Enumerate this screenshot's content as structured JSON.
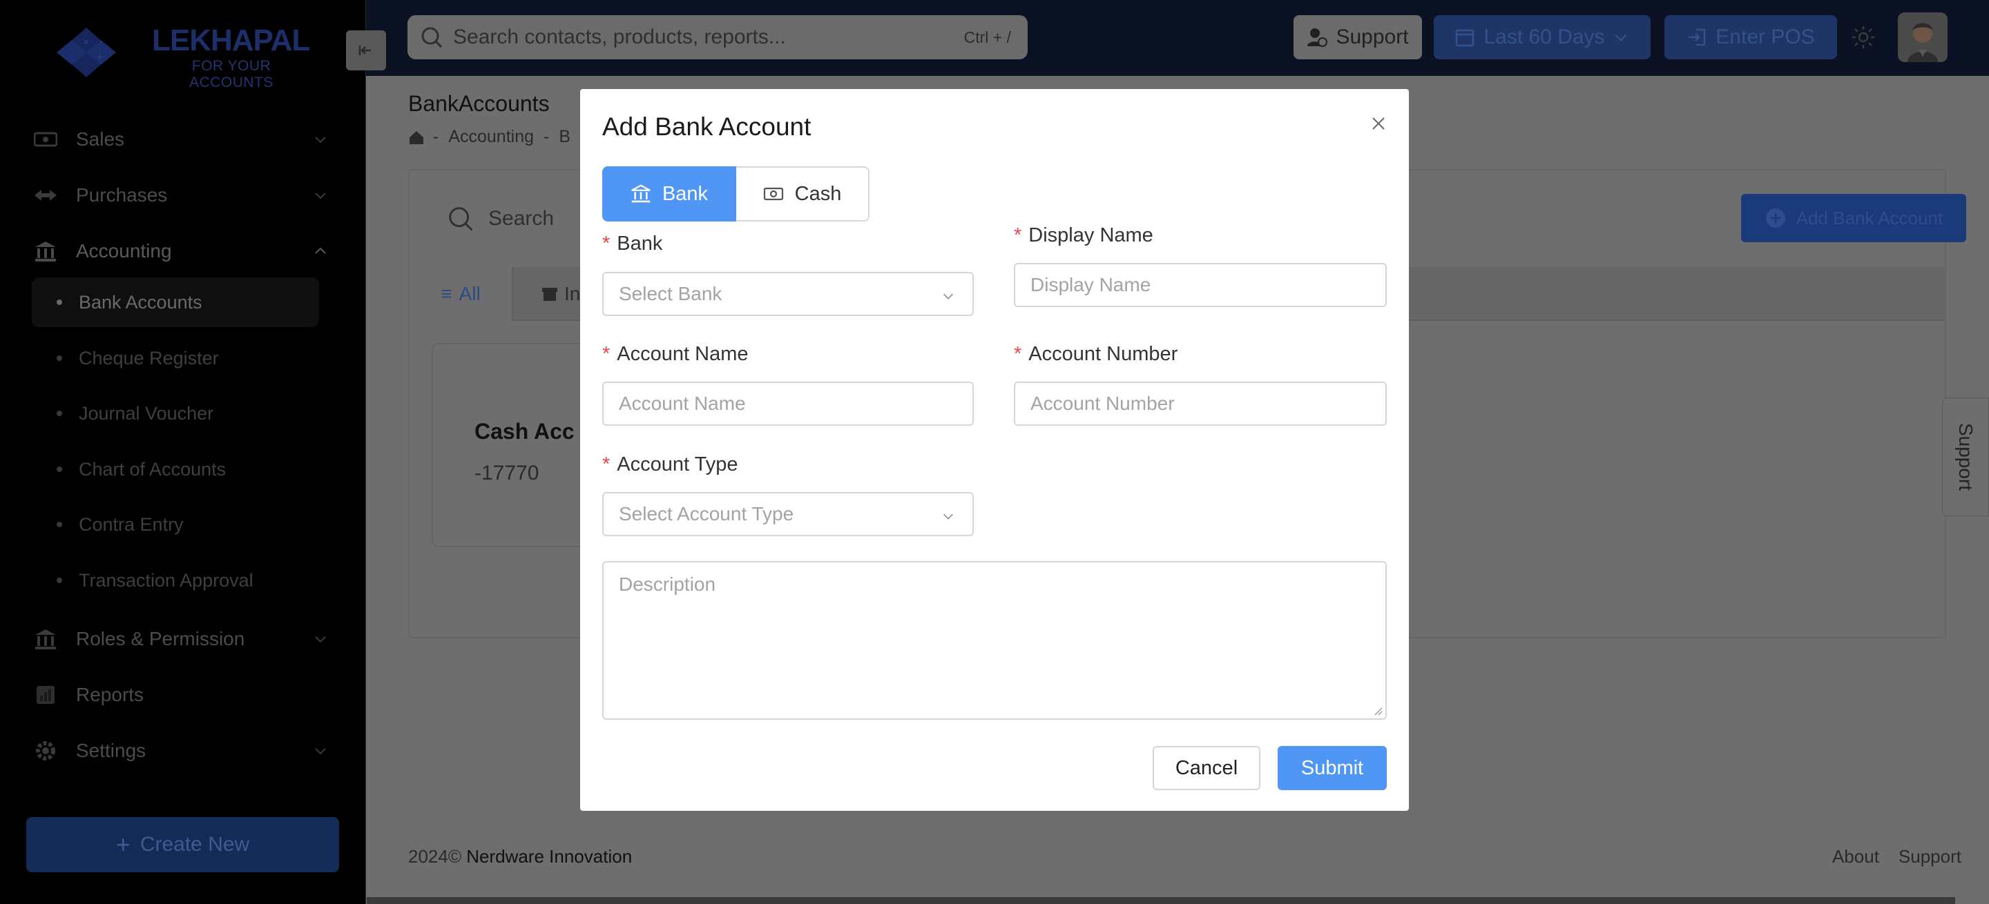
{
  "brand": {
    "title": "LEKHAPAL",
    "subtitle": "FOR YOUR ACCOUNTS"
  },
  "topbar": {
    "search_placeholder": "Search contacts, products, reports...",
    "search_shortcut": "Ctrl + /",
    "support_label": "Support",
    "date_range_label": "Last 60 Days",
    "enter_pos_label": "Enter POS"
  },
  "sidebar": {
    "items": [
      {
        "label": "Sales"
      },
      {
        "label": "Purchases"
      },
      {
        "label": "Accounting"
      },
      {
        "label": "Roles & Permission"
      },
      {
        "label": "Reports"
      },
      {
        "label": "Settings"
      }
    ],
    "accounting_sub": [
      {
        "label": "Bank Accounts"
      },
      {
        "label": "Cheque Register"
      },
      {
        "label": "Journal Voucher"
      },
      {
        "label": "Chart of Accounts"
      },
      {
        "label": "Contra Entry"
      },
      {
        "label": "Transaction Approval"
      }
    ],
    "create_new_label": "Create New"
  },
  "main": {
    "page_title": "BankAccounts",
    "breadcrumb": [
      "Accounting",
      "B"
    ],
    "search_label": "Search",
    "add_bank_account_label": "Add Bank Account",
    "tabs": [
      {
        "label": "All"
      },
      {
        "label": "In"
      }
    ],
    "account_card": {
      "name": "Cash Acc",
      "balance": "-17770"
    }
  },
  "footer": {
    "year": "2024©",
    "company": "Nerdware Innovation",
    "links": [
      "About",
      "Support"
    ]
  },
  "support_tab_label": "Support",
  "modal": {
    "title": "Add Bank Account",
    "tabs": {
      "bank": "Bank",
      "cash": "Cash"
    },
    "fields": {
      "bank": {
        "label": "Bank",
        "placeholder": "Select Bank"
      },
      "display_name": {
        "label": "Display Name",
        "placeholder": "Display Name"
      },
      "account_name": {
        "label": "Account Name",
        "placeholder": "Account Name"
      },
      "account_number": {
        "label": "Account Number",
        "placeholder": "Account Number"
      },
      "account_type": {
        "label": "Account Type",
        "placeholder": "Select Account Type"
      },
      "description": {
        "placeholder": "Description"
      }
    },
    "required_mark": "*",
    "cancel_label": "Cancel",
    "submit_label": "Submit"
  },
  "colors": {
    "primary": "#4f96f5",
    "required": "#e5484d",
    "overlay": "#6e6e6e",
    "sidebar_bg": "#000000",
    "topbar_bg": "#0b1223"
  }
}
